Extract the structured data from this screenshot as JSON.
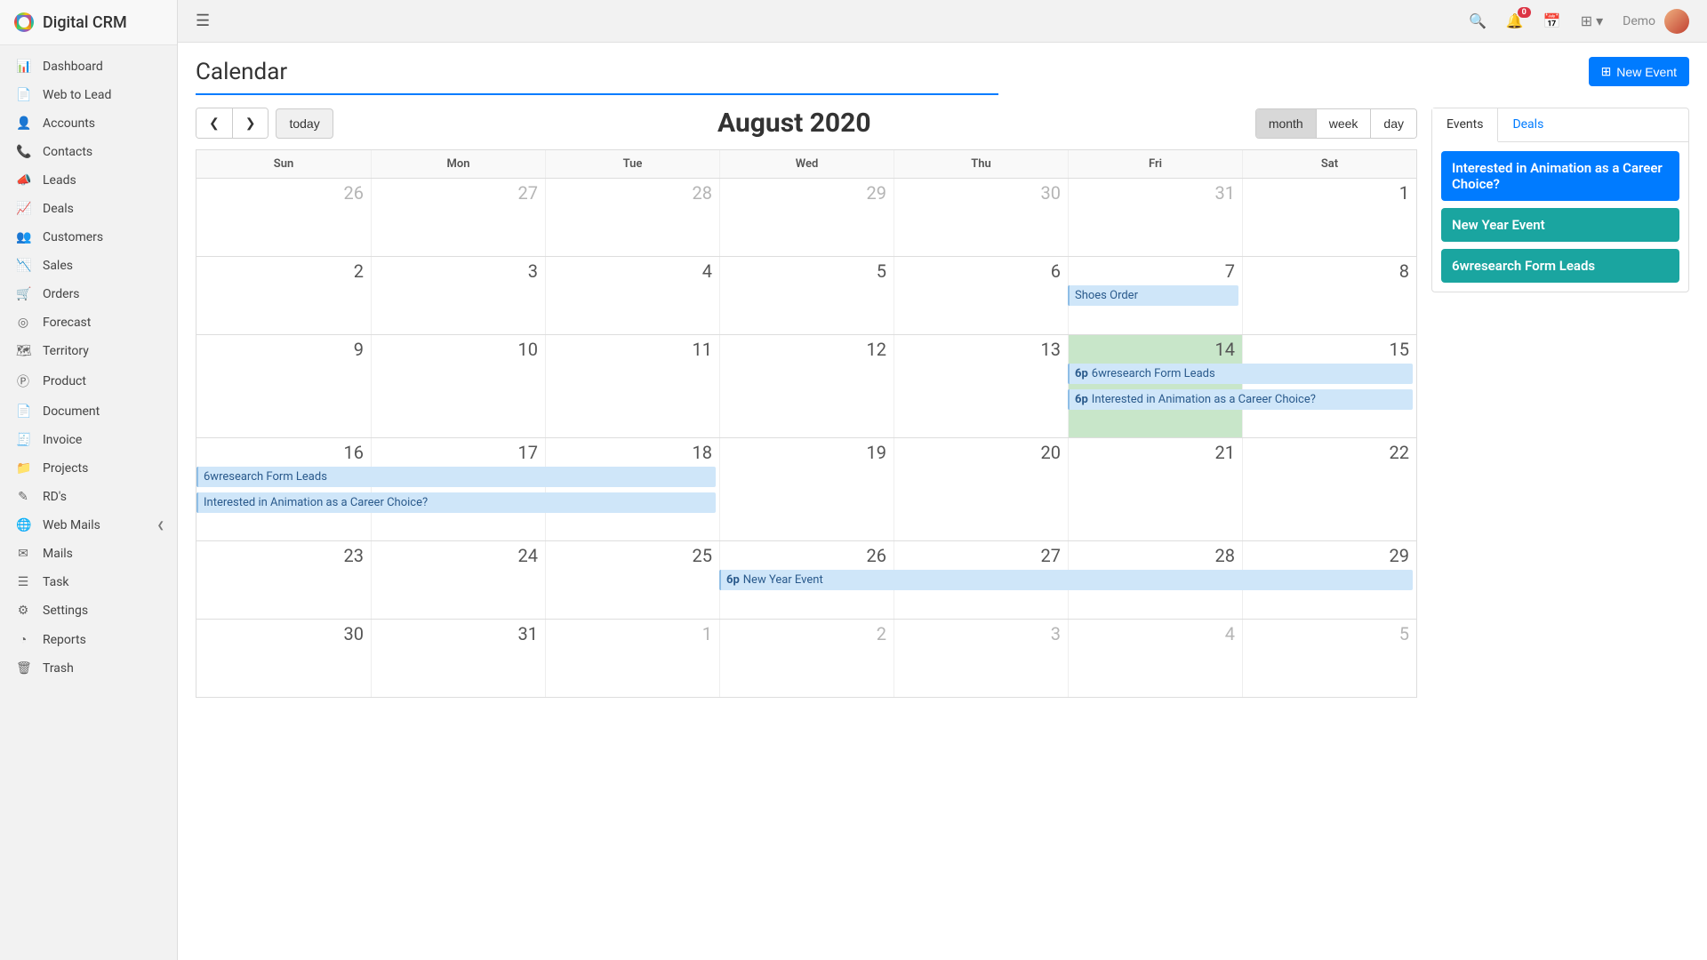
{
  "brand": "Digital CRM",
  "sidebar": {
    "items": [
      {
        "label": "Dashboard",
        "icon": "📊"
      },
      {
        "label": "Web to Lead",
        "icon": "📄"
      },
      {
        "label": "Accounts",
        "icon": "👤"
      },
      {
        "label": "Contacts",
        "icon": "📞"
      },
      {
        "label": "Leads",
        "icon": "📣"
      },
      {
        "label": "Deals",
        "icon": "📈"
      },
      {
        "label": "Customers",
        "icon": "👥"
      },
      {
        "label": "Sales",
        "icon": "📉"
      },
      {
        "label": "Orders",
        "icon": "🛒"
      },
      {
        "label": "Forecast",
        "icon": "◎"
      },
      {
        "label": "Territory",
        "icon": "🗺"
      },
      {
        "label": "Product",
        "icon": "Ⓟ"
      },
      {
        "label": "Document",
        "icon": "📄"
      },
      {
        "label": "Invoice",
        "icon": "🧾"
      },
      {
        "label": "Projects",
        "icon": "📁"
      },
      {
        "label": "RD's",
        "icon": "✎"
      },
      {
        "label": "Web Mails",
        "icon": "🌐",
        "expandable": true
      },
      {
        "label": "Mails",
        "icon": "✉"
      },
      {
        "label": "Task",
        "icon": "☰"
      },
      {
        "label": "Settings",
        "icon": "⚙"
      },
      {
        "label": "Reports",
        "icon": "◔"
      },
      {
        "label": "Trash",
        "icon": "🗑"
      }
    ]
  },
  "topbar": {
    "notification_count": "0",
    "user": "Demo"
  },
  "page": {
    "title": "Calendar",
    "new_event": "New Event"
  },
  "calendar": {
    "title": "August 2020",
    "today": "today",
    "views": {
      "month": "month",
      "week": "week",
      "day": "day"
    },
    "day_headers": [
      "Sun",
      "Mon",
      "Tue",
      "Wed",
      "Thu",
      "Fri",
      "Sat"
    ],
    "weeks": [
      {
        "days": [
          {
            "n": "26",
            "other": true
          },
          {
            "n": "27",
            "other": true
          },
          {
            "n": "28",
            "other": true
          },
          {
            "n": "29",
            "other": true
          },
          {
            "n": "30",
            "other": true
          },
          {
            "n": "31",
            "other": true
          },
          {
            "n": "1"
          }
        ],
        "events": []
      },
      {
        "days": [
          {
            "n": "2"
          },
          {
            "n": "3"
          },
          {
            "n": "4"
          },
          {
            "n": "5"
          },
          {
            "n": "6"
          },
          {
            "n": "7"
          },
          {
            "n": "8"
          }
        ],
        "events": [
          {
            "title": "Shoes Order",
            "start": 5,
            "span": 1,
            "row": 0
          }
        ]
      },
      {
        "days": [
          {
            "n": "9"
          },
          {
            "n": "10"
          },
          {
            "n": "11"
          },
          {
            "n": "12"
          },
          {
            "n": "13"
          },
          {
            "n": "14",
            "today": true
          },
          {
            "n": "15"
          }
        ],
        "events": [
          {
            "time": "6p",
            "title": "6wresearch Form Leads",
            "start": 5,
            "span": 2,
            "row": 0
          },
          {
            "time": "6p",
            "title": "Interested in Animation as a Career Choice?",
            "start": 5,
            "span": 2,
            "row": 1
          }
        ]
      },
      {
        "days": [
          {
            "n": "16"
          },
          {
            "n": "17"
          },
          {
            "n": "18"
          },
          {
            "n": "19"
          },
          {
            "n": "20"
          },
          {
            "n": "21"
          },
          {
            "n": "22"
          }
        ],
        "events": [
          {
            "title": "6wresearch Form Leads",
            "start": 0,
            "span": 3,
            "row": 0
          },
          {
            "title": "Interested in Animation as a Career Choice?",
            "start": 0,
            "span": 3,
            "row": 1
          }
        ]
      },
      {
        "days": [
          {
            "n": "23"
          },
          {
            "n": "24"
          },
          {
            "n": "25"
          },
          {
            "n": "26"
          },
          {
            "n": "27"
          },
          {
            "n": "28"
          },
          {
            "n": "29"
          }
        ],
        "events": [
          {
            "time": "6p",
            "title": "New Year Event",
            "start": 3,
            "span": 4,
            "row": 0
          }
        ]
      },
      {
        "days": [
          {
            "n": "30"
          },
          {
            "n": "31"
          },
          {
            "n": "1",
            "other": true
          },
          {
            "n": "2",
            "other": true
          },
          {
            "n": "3",
            "other": true
          },
          {
            "n": "4",
            "other": true
          },
          {
            "n": "5",
            "other": true
          }
        ],
        "events": []
      }
    ]
  },
  "side_panel": {
    "tabs": {
      "events": "Events",
      "deals": "Deals"
    },
    "items": [
      {
        "title": "Interested in Animation as a Career Choice?",
        "color": "blue"
      },
      {
        "title": "New Year Event",
        "color": "teal"
      },
      {
        "title": "6wresearch Form Leads",
        "color": "teal"
      }
    ]
  }
}
